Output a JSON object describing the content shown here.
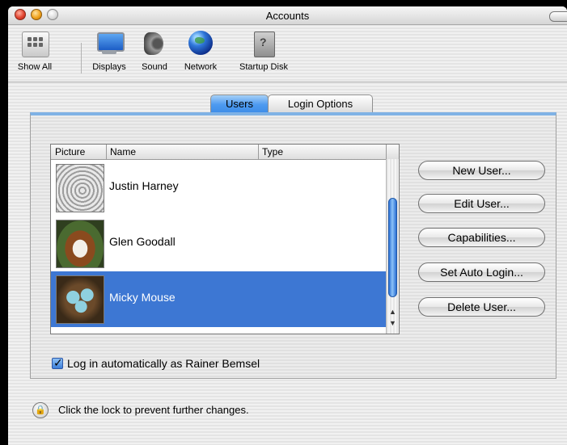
{
  "window": {
    "title": "Accounts"
  },
  "toolbar": {
    "items": [
      {
        "label": "Show All",
        "icon": "show-all-icon"
      },
      {
        "label": "Displays",
        "icon": "display-icon"
      },
      {
        "label": "Sound",
        "icon": "speaker-icon"
      },
      {
        "label": "Network",
        "icon": "globe-icon"
      },
      {
        "label": "Startup Disk",
        "icon": "startup-disk-icon"
      }
    ]
  },
  "tabs": [
    {
      "label": "Users",
      "selected": true
    },
    {
      "label": "Login Options",
      "selected": false
    }
  ],
  "users_list": {
    "columns": [
      "Picture",
      "Name",
      "Type"
    ],
    "rows": [
      {
        "name": "Justin Harney",
        "type": "",
        "picture": "zen-garden-picture",
        "selected": false
      },
      {
        "name": "Glen Goodall",
        "type": "",
        "picture": "dog-picture",
        "selected": false
      },
      {
        "name": "Micky Mouse",
        "type": "",
        "picture": "nest-eggs-picture",
        "selected": true
      }
    ]
  },
  "buttons": {
    "new_user": "New User...",
    "edit_user": "Edit User...",
    "capabilities": "Capabilities...",
    "set_auto_login": "Set Auto Login...",
    "delete_user": "Delete User..."
  },
  "auto_login": {
    "label": "Log in automatically as Rainer Bemsel",
    "checked": true
  },
  "lock": {
    "label": "Click the lock to prevent further changes."
  },
  "colors": {
    "selection": "#3d77d3",
    "tab_selected": "#4d9af0",
    "panel_accent": "#7fb2e5"
  }
}
